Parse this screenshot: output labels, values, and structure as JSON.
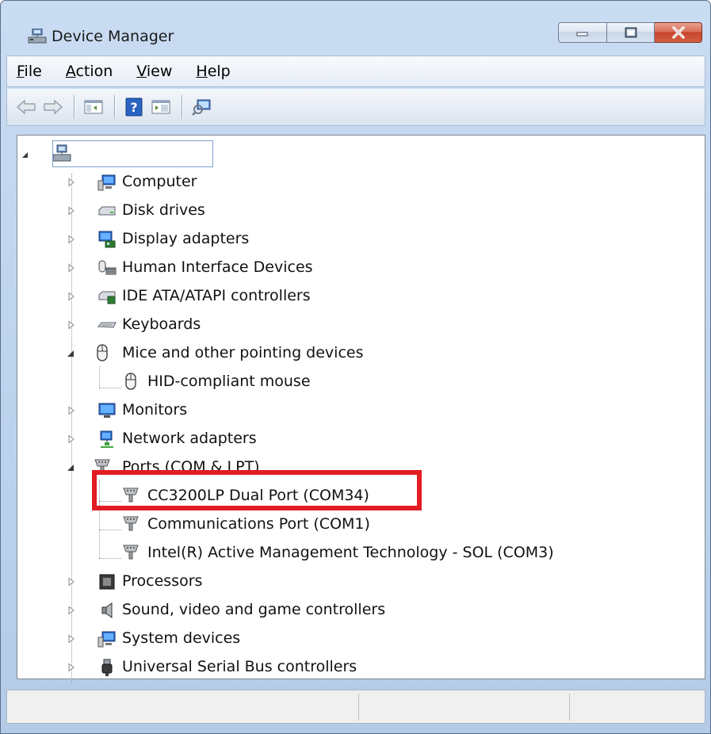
{
  "window": {
    "title": "Device Manager"
  },
  "menu": {
    "items": [
      {
        "label": "File",
        "accel": "F",
        "rest": "ile"
      },
      {
        "label": "Action",
        "accel": "A",
        "rest": "ction"
      },
      {
        "label": "View",
        "accel": "V",
        "rest": "iew"
      },
      {
        "label": "Help",
        "accel": "H",
        "rest": "elp"
      }
    ]
  },
  "toolbar": {
    "buttons": [
      "back-icon",
      "forward-icon",
      "show-hide-console-tree-icon",
      "help-icon",
      "properties-icon",
      "scan-hardware-icon"
    ]
  },
  "tree": {
    "root_name": "",
    "categories": [
      {
        "label": "Computer",
        "icon": "computer-icon",
        "expanded": false
      },
      {
        "label": "Disk drives",
        "icon": "disk-drive-icon",
        "expanded": false
      },
      {
        "label": "Display adapters",
        "icon": "display-adapter-icon",
        "expanded": false
      },
      {
        "label": "Human Interface Devices",
        "icon": "hid-icon",
        "expanded": false
      },
      {
        "label": "IDE ATA/ATAPI controllers",
        "icon": "ide-controller-icon",
        "expanded": false
      },
      {
        "label": "Keyboards",
        "icon": "keyboard-icon",
        "expanded": false
      },
      {
        "label": "Mice and other pointing devices",
        "icon": "mouse-icon",
        "expanded": true,
        "children": [
          "HID-compliant mouse"
        ]
      },
      {
        "label": "Monitors",
        "icon": "monitor-icon",
        "expanded": false
      },
      {
        "label": "Network adapters",
        "icon": "network-adapter-icon",
        "expanded": false
      },
      {
        "label": "Ports (COM & LPT)",
        "icon": "port-icon",
        "expanded": true,
        "children": [
          "CC3200LP Dual Port (COM34)",
          "Communications Port (COM1)",
          "Intel(R) Active Management Technology - SOL (COM3)"
        ]
      },
      {
        "label": "Processors",
        "icon": "processor-icon",
        "expanded": false
      },
      {
        "label": "Sound, video and game controllers",
        "icon": "sound-icon",
        "expanded": false
      },
      {
        "label": "System devices",
        "icon": "system-devices-icon",
        "expanded": false
      },
      {
        "label": "Universal Serial Bus controllers",
        "icon": "usb-icon",
        "expanded": false
      }
    ]
  },
  "colors": {
    "highlight": "#e21d24",
    "title_bar": "#c9dcf2",
    "close_button": "#c8452c"
  }
}
